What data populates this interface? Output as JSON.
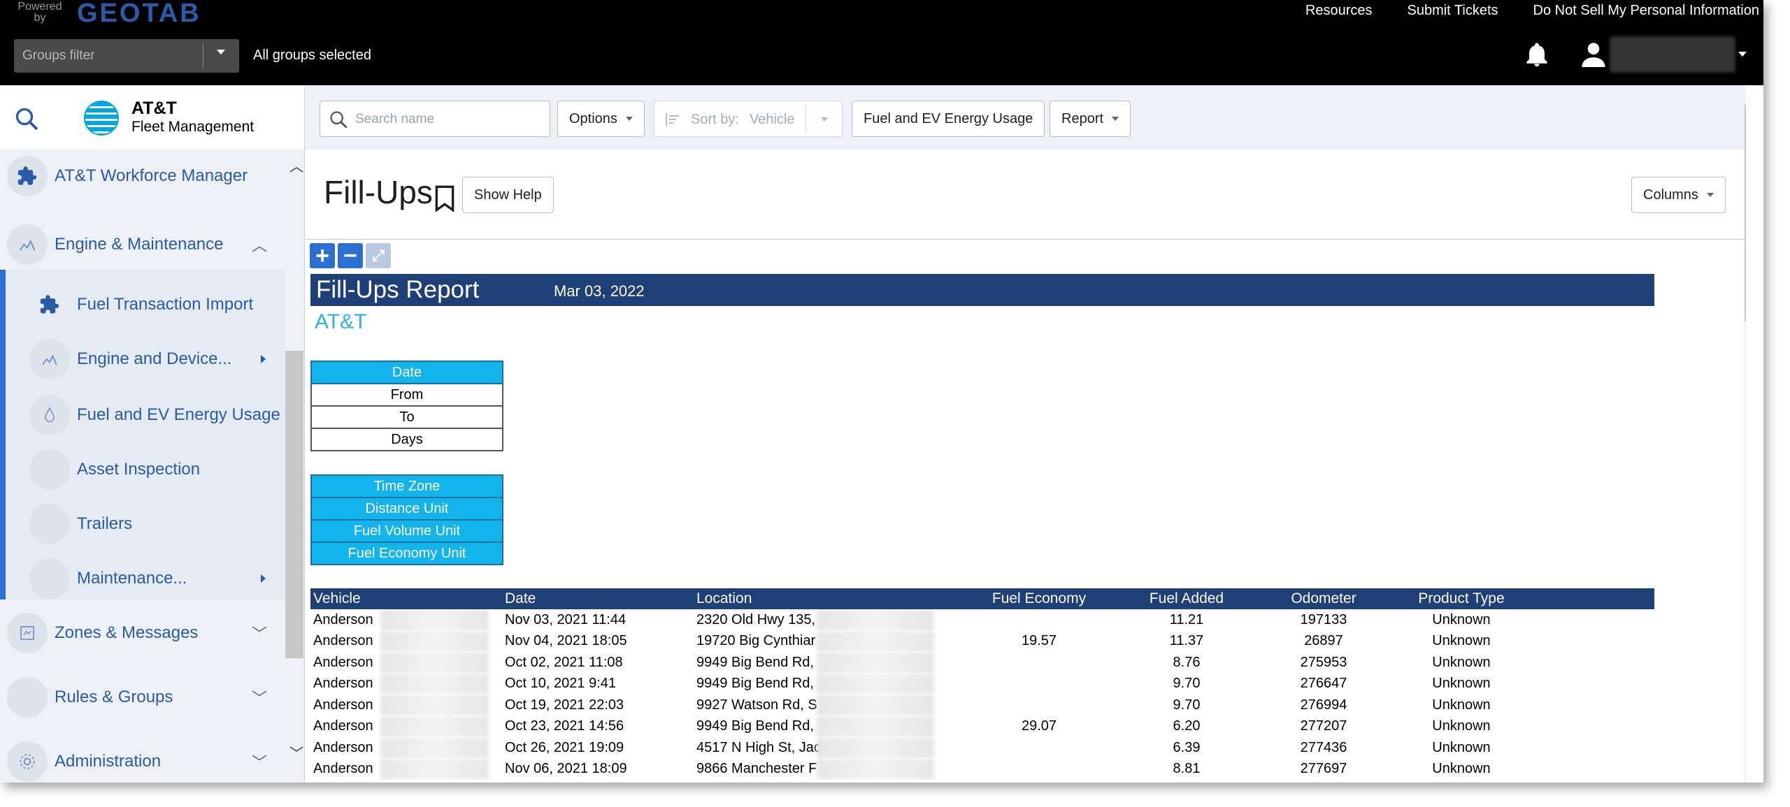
{
  "topbar": {
    "powered_by": "Powered by",
    "brand": "GEOTAB",
    "links": [
      "Resources",
      "Submit Tickets",
      "Do Not Sell My Personal Information"
    ],
    "groups_filter_placeholder": "Groups filter",
    "groups_status": "All groups selected"
  },
  "sidebar": {
    "logo_name": "AT&T",
    "logo_sub": "Fleet Management",
    "items": [
      {
        "label": "AT&T Workforce Manager",
        "icon": "puzzle-icon"
      },
      {
        "label": "Engine & Maintenance",
        "icon": "engine-icon"
      },
      {
        "label": "Fuel Transaction Import",
        "icon": "puzzle-icon"
      },
      {
        "label": "Engine and Device...",
        "icon": "engine-icon"
      },
      {
        "label": "Fuel and EV Energy Usage",
        "icon": "fuel-drop-icon"
      },
      {
        "label": "Asset Inspection",
        "icon": "blank-icon"
      },
      {
        "label": "Trailers",
        "icon": "blank-icon"
      },
      {
        "label": "Maintenance...",
        "icon": "blank-icon"
      },
      {
        "label": "Zones & Messages",
        "icon": "zones-icon"
      },
      {
        "label": "Rules & Groups",
        "icon": "blank-icon"
      },
      {
        "label": "Administration",
        "icon": "gear-icon"
      }
    ]
  },
  "toolbar": {
    "search_placeholder": "Search name",
    "options": "Options",
    "sort_label": "Sort by:",
    "sort_value": "Vehicle",
    "fuel_button": "Fuel and EV Energy Usage",
    "report": "Report"
  },
  "page": {
    "title": "Fill-Ups",
    "show_help": "Show Help",
    "columns": "Columns"
  },
  "report": {
    "title": "Fill-Ups Report",
    "date": "Mar 03, 2022",
    "company": "AT&T",
    "params1": [
      "Date",
      "From",
      "To",
      "Days"
    ],
    "params2": [
      "Time Zone",
      "Distance Unit",
      "Fuel Volume Unit",
      "Fuel Economy Unit"
    ],
    "columns": [
      "Vehicle",
      "Date",
      "Location",
      "Fuel Economy",
      "Fuel Added",
      "Odometer",
      "Product Type"
    ],
    "rows": [
      [
        "Anderson",
        "Nov 03, 2021 11:44",
        "2320 Old Hwy 135,",
        "",
        "11.21",
        "197133",
        "Unknown"
      ],
      [
        "Anderson",
        "Nov 04, 2021 18:05",
        "19720 Big Cynthiar",
        "19.57",
        "11.37",
        "26897",
        "Unknown"
      ],
      [
        "Anderson",
        "Oct 02, 2021 11:08",
        "9949 Big Bend Rd,",
        "",
        "8.76",
        "275953",
        "Unknown"
      ],
      [
        "Anderson",
        "Oct 10, 2021 9:41",
        "9949 Big Bend Rd,",
        "",
        "9.70",
        "276647",
        "Unknown"
      ],
      [
        "Anderson",
        "Oct 19, 2021 22:03",
        "9927 Watson Rd, S",
        "",
        "9.70",
        "276994",
        "Unknown"
      ],
      [
        "Anderson",
        "Oct 23, 2021 14:56",
        "9949 Big Bend Rd,",
        "29.07",
        "6.20",
        "277207",
        "Unknown"
      ],
      [
        "Anderson",
        "Oct 26, 2021 19:09",
        "4517 N High St, Jac",
        "",
        "6.39",
        "277436",
        "Unknown"
      ],
      [
        "Anderson",
        "Nov 06, 2021 18:09",
        "9866 Manchester F",
        "",
        "8.81",
        "277697",
        "Unknown"
      ]
    ]
  }
}
